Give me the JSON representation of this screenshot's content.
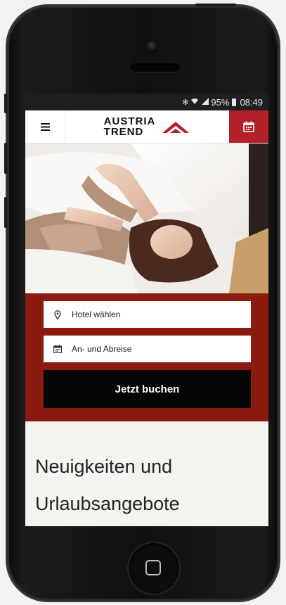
{
  "status_bar": {
    "battery": "95%",
    "time": "08:49"
  },
  "header": {
    "logo_line1": "AUSTRIA",
    "logo_line2": "TREND"
  },
  "booking": {
    "hotel_field_label": "Hotel wählen",
    "dates_field_label": "An- und Abreise",
    "book_button_label": "Jetzt buchen"
  },
  "news": {
    "title": "Neuigkeiten und Urlaubsangebote"
  },
  "colors": {
    "accent_red": "#b4202a",
    "booking_bg": "#8b1a10",
    "button_black": "#050505"
  }
}
